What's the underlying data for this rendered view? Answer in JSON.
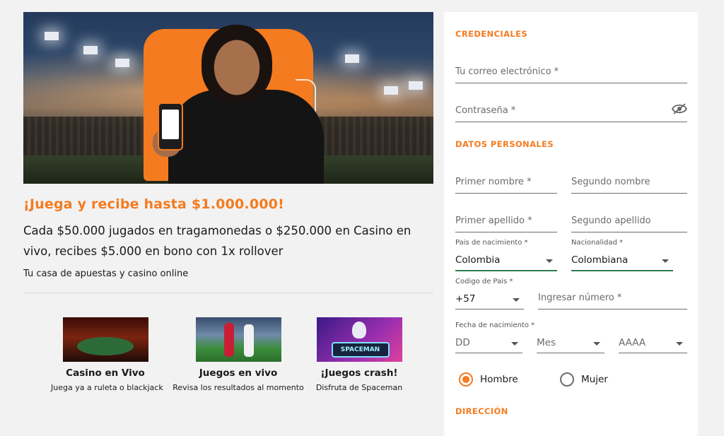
{
  "promo": {
    "title": "¡Juega y recibe hasta $1.000.000!",
    "body": "Cada $50.000 jugados en tragamonedas o $250.000 en Casino en vivo, recibes $5.000 en bono con 1x rollover",
    "tagline": "Tu casa de apuestas y casino online"
  },
  "cards": [
    {
      "title": "Casino en Vivo",
      "subtitle": "Juega ya a ruleta o blackjack"
    },
    {
      "title": "Juegos en vivo",
      "subtitle": "Revisa los resultados al momento"
    },
    {
      "title": "¡Juegos crash!",
      "subtitle": "Disfruta de Spaceman",
      "badge": "SPACEMAN"
    }
  ],
  "form": {
    "credentials_title": "CREDENCIALES",
    "email_placeholder": "Tu correo electrónico *",
    "password_placeholder": "Contraseña *",
    "personal_title": "DATOS PERSONALES",
    "first_name_placeholder": "Primer nombre *",
    "second_name_placeholder": "Segundo nombre",
    "first_surname_placeholder": "Primer apellido *",
    "second_surname_placeholder": "Segundo apellido",
    "birth_country_label": "Pais de nacimiento *",
    "birth_country_value": "Colombia",
    "nationality_label": "Nacionalidad *",
    "nationality_value": "Colombiana",
    "country_code_label": "Codigo de Pais *",
    "country_code_value": "+57",
    "phone_placeholder": "Ingresar número *",
    "birth_date_label": "Fecha de nacimiento *",
    "day_placeholder": "DD",
    "month_placeholder": "Mes",
    "year_placeholder": "AAAA",
    "gender_male": "Hombre",
    "gender_female": "Mujer",
    "gender_selected": "Hombre",
    "address_title": "DIRECCIÓN"
  },
  "colors": {
    "accent": "#f47b20",
    "active_underline": "#2e7d4f"
  }
}
